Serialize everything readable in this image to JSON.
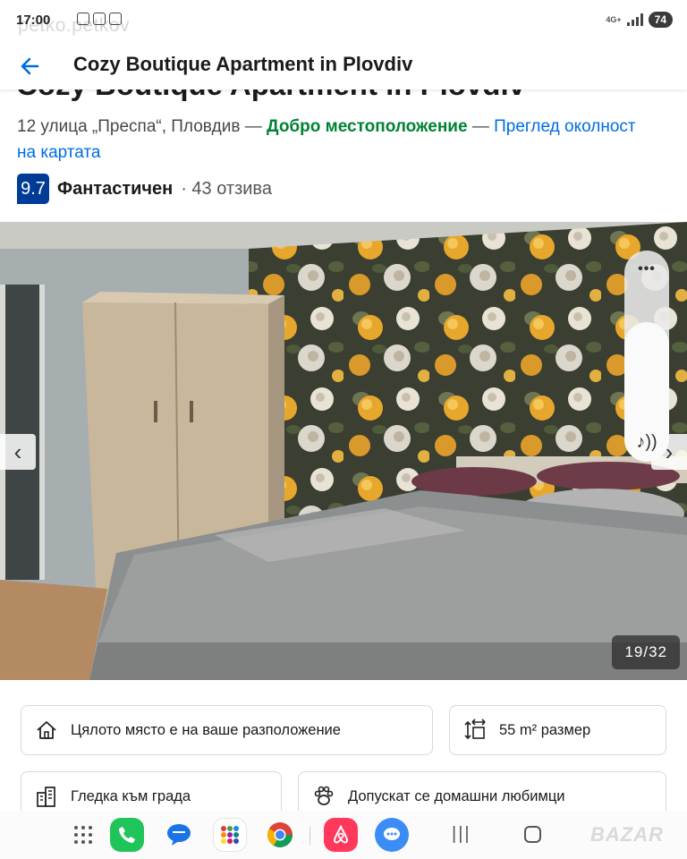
{
  "status_bar": {
    "time": "17:00",
    "ghost_text": "petko.petkov",
    "network": "4G+",
    "battery": "74"
  },
  "header": {
    "title": "Cozy Boutique Apartment in Plovdiv"
  },
  "listing": {
    "title": "Cozy Boutique Apartment in Plovdiv",
    "address": "12 улица „Преспа“, Пловдив — ",
    "location_rating": "Добро местоположение",
    "separator": " — ",
    "map_link": "Преглед околност на картата",
    "score": "9.7",
    "rating_word": "Фантастичен",
    "review_count": "· 43 отзива"
  },
  "gallery": {
    "counter": "19/32",
    "prev_arrow": "‹",
    "next_arrow": "›"
  },
  "volume": {
    "more": "•••",
    "level": 0.66
  },
  "amenities": [
    {
      "label": "Цялото място е на ваше разположение",
      "icon": "house-icon"
    },
    {
      "label": "55 m² размер",
      "icon": "resize-icon"
    },
    {
      "label": "Гледка към града",
      "icon": "city-icon"
    },
    {
      "label": "Допускат се домашни любимци",
      "icon": "paw-icon"
    }
  ],
  "taskbar": {
    "watermark": "BAZAR"
  }
}
